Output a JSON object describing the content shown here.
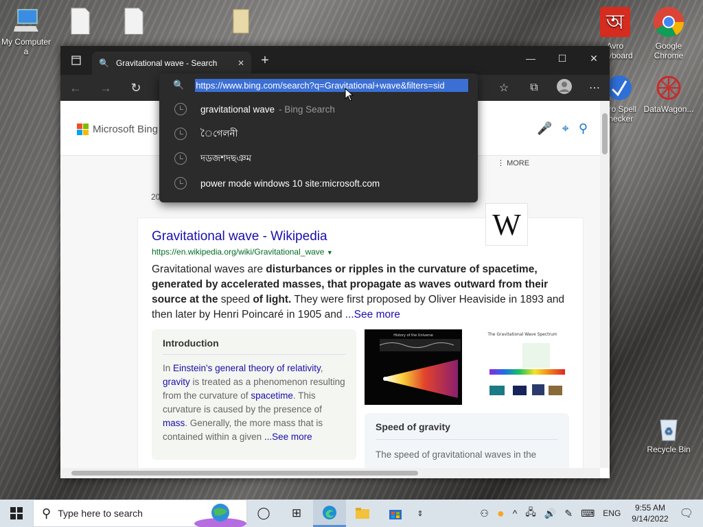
{
  "desktop": {
    "icons": [
      {
        "label": "My Computer a",
        "x": 0
      },
      {
        "label": "Avro Keyboard"
      },
      {
        "label": "Google Chrome"
      },
      {
        "label": "Avro Spell Checker"
      },
      {
        "label": "DataWagon..."
      },
      {
        "label": "Recycle Bin"
      }
    ]
  },
  "browser": {
    "tab_title": "Gravitational wave - Search",
    "address": "https://www.bing.com/search?q=Gravitational+wave&filters=sid",
    "suggestions": [
      {
        "text": "gravitational wave",
        "sub": "- Bing Search"
      },
      {
        "text": "ৈগেলনী",
        "sub": ""
      },
      {
        "text": "দডজশদছঞম",
        "sub": ""
      },
      {
        "text": "power mode windows 10 site:microsoft.com",
        "sub": ""
      }
    ]
  },
  "bing": {
    "logo_text": "Microsoft Bing",
    "more_label": "MORE",
    "year_fragment": "20",
    "result": {
      "title": "Gravitational wave - Wikipedia",
      "url": "https://en.wikipedia.org/wiki/Gravitational_wave",
      "snippet_1": "Gravitational waves are ",
      "snippet_bold_1": "disturbances or ripples in the curvature of spacetime, generated by accelerated masses, that propagate as waves outward from their source at the",
      "snippet_2": " speed ",
      "snippet_bold_2": "of light.",
      "snippet_3": " They were first proposed by Oliver Heaviside in 1893 and then later by Henri Poincaré in 1905 and ",
      "see_more": "...See more",
      "wiki_logo": "W"
    },
    "intro": {
      "heading": "Introduction",
      "t1": "In ",
      "l1": "Einstein's general theory of relativity",
      "t2": ", ",
      "l2": "gravity",
      "t3": " is treated as a phenomenon resulting from the curvature of ",
      "l3": "spacetime",
      "t4": ". This curvature is caused by the presence of ",
      "l4": "mass",
      "t5": ". Generally, the more mass that is contained within a given ",
      "see_more": "...See more"
    },
    "image_captions": {
      "img1": "History of the Universe",
      "img2": "The Gravitational Wave Spectrum"
    },
    "speed": {
      "heading": "Speed of gravity",
      "text": "The speed of gravitational waves in the"
    }
  },
  "taskbar": {
    "search_placeholder": "Type here to search",
    "language": "ENG",
    "time": "9:55 AM",
    "date": "9/14/2022"
  }
}
